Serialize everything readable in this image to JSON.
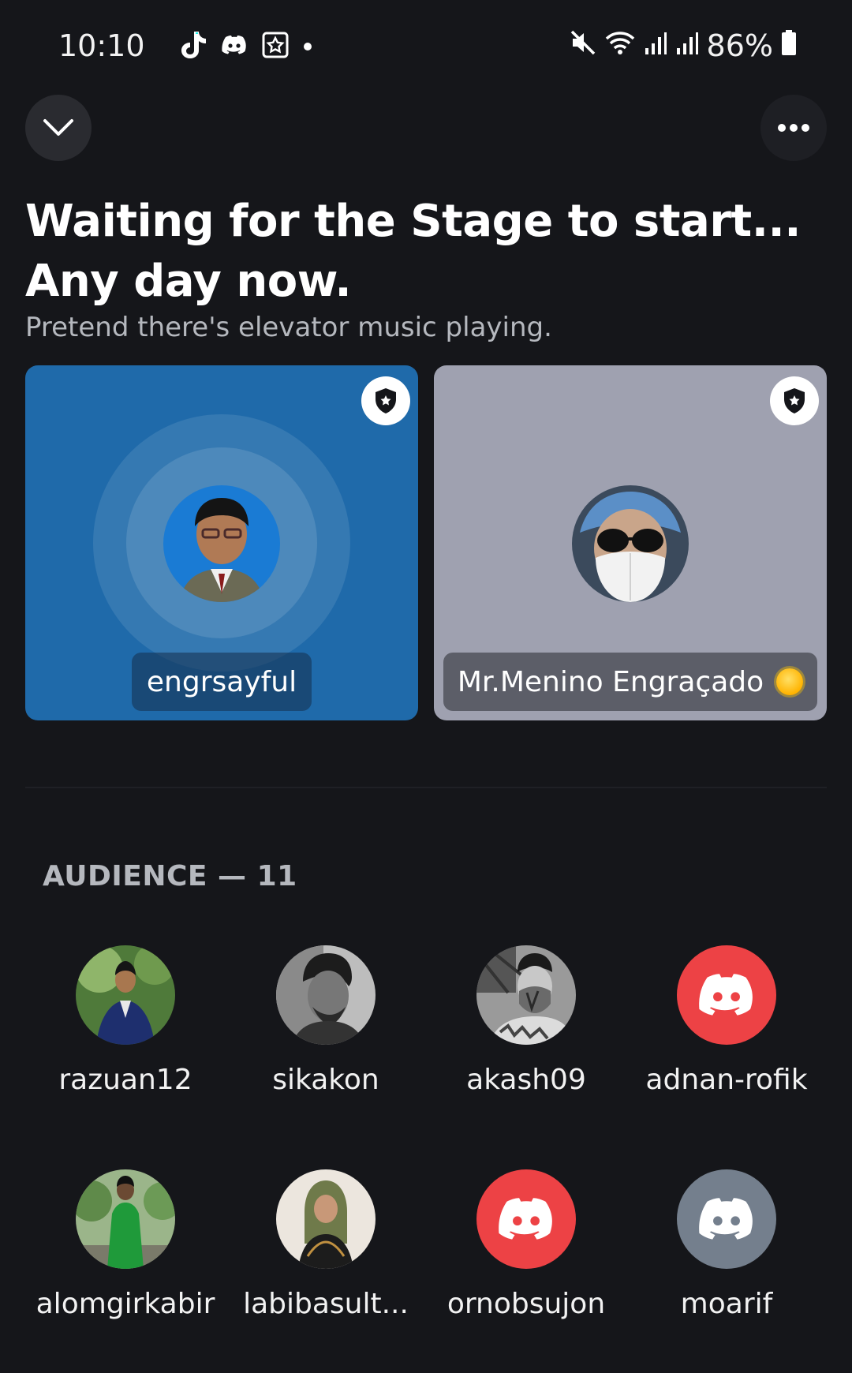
{
  "status_bar": {
    "time": "10:10",
    "battery": "86%",
    "left_icons": [
      "tiktok-icon",
      "discord-icon",
      "star-app-icon",
      "dot-icon"
    ],
    "right_icons": [
      "mute-icon",
      "wifi-icon",
      "signal-icon",
      "signal-icon",
      "battery-icon"
    ]
  },
  "header": {
    "title_line1": "Waiting for the Stage to start...",
    "title_line2": "Any day now.",
    "subtitle": "Pretend there's elevator music playing."
  },
  "speakers": [
    {
      "name": "engrsayful",
      "color": "#1f6aaa",
      "badge": "moderator-shield-icon"
    },
    {
      "name": "Mr.Menino Engraçado",
      "color": "#9fa1b0",
      "badge": "moderator-shield-icon",
      "emoji": "sun-icon"
    }
  ],
  "audience": {
    "header": "AUDIENCE — 11",
    "members": [
      {
        "name": "razuan12"
      },
      {
        "name": "sikakon"
      },
      {
        "name": "akash09"
      },
      {
        "name": "adnan-rofik",
        "default_avatar": "#ed4245"
      },
      {
        "name": "alomgirkabir"
      },
      {
        "name": "labibasult..."
      },
      {
        "name": "ornobsujon",
        "default_avatar": "#ed4245"
      },
      {
        "name": "moarif",
        "default_avatar": "#747f8d"
      }
    ]
  },
  "colors": {
    "background": "#15161a",
    "discord_red": "#ed4245",
    "discord_grey": "#747f8d"
  }
}
